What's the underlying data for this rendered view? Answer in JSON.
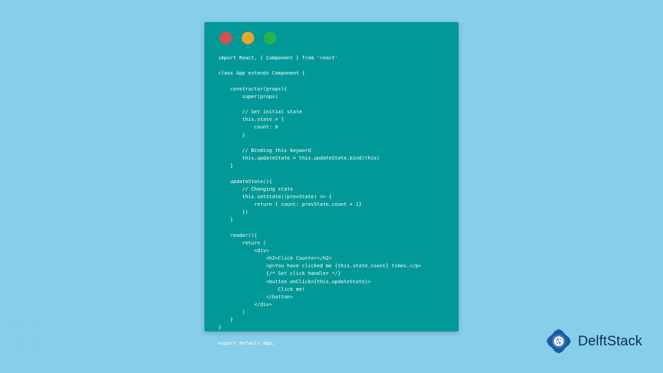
{
  "window": {
    "controls": [
      "red",
      "yellow",
      "green"
    ]
  },
  "code": {
    "lines": "import React, { Component } from 'react'\n\nclass App extends Component {\n\n    constructor(props){\n        super(props)\n\n        // Set initial state\n        this.state = {\n            count: 0\n        }\n\n        // Binding this keyword\n        this.updateState = this.updateState.bind(this)\n    }\n\n    updateState(){\n        // Changing state\n        this.setState((prevState) => {\n            return { count: prevState.count + 1}\n        })\n    }\n\n    render(){\n        return (\n            <div>\n                <h2>Click Counter</h2>\n                <p>You have clicked me {this.state.count} times.</p>\n                {/* Set click handler */}\n                <button onClick={this.updateState}>\n                    Click me!\n                </button>\n            </div>\n        )\n    }\n}\n\nexport default App;"
  },
  "branding": {
    "name": "DelftStack"
  }
}
